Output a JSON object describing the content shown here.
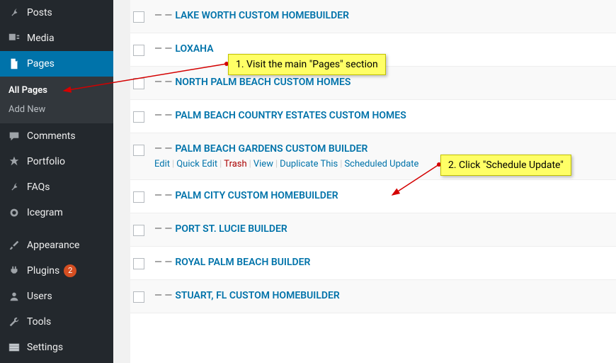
{
  "sidebar": {
    "items": [
      {
        "label": "Posts",
        "icon": "pin"
      },
      {
        "label": "Media",
        "icon": "media"
      },
      {
        "label": "Pages",
        "icon": "page",
        "active": true
      },
      {
        "label": "Comments",
        "icon": "comment"
      },
      {
        "label": "Portfolio",
        "icon": "star"
      },
      {
        "label": "FAQs",
        "icon": "pin"
      },
      {
        "label": "Icegram",
        "icon": "circle"
      },
      {
        "label": "Appearance",
        "icon": "brush"
      },
      {
        "label": "Plugins",
        "icon": "plug",
        "badge": "2"
      },
      {
        "label": "Users",
        "icon": "user"
      },
      {
        "label": "Tools",
        "icon": "wrench"
      },
      {
        "label": "Settings",
        "icon": "sliders"
      }
    ],
    "sub": {
      "all_pages": "All Pages",
      "add_new": "Add New"
    }
  },
  "pages": [
    {
      "prefix": "— —",
      "title": "LAKE WORTH CUSTOM HOMEBUILDER"
    },
    {
      "prefix": "— —",
      "title": "LOXAHA"
    },
    {
      "prefix": "— —",
      "title": "NORTH PALM BEACH CUSTOM HOMES"
    },
    {
      "prefix": "— —",
      "title": "PALM BEACH COUNTRY ESTATES CUSTOM HOMES"
    },
    {
      "prefix": "— —",
      "title": "PALM BEACH GARDENS CUSTOM BUILDER",
      "hover": true
    },
    {
      "prefix": "— —",
      "title": "PALM CITY CUSTOM HOMEBUILDER"
    },
    {
      "prefix": "— —",
      "title": "PORT ST. LUCIE BUILDER"
    },
    {
      "prefix": "— —",
      "title": "ROYAL PALM BEACH BUILDER"
    },
    {
      "prefix": "— —",
      "title": "STUART, FL CUSTOM HOMEBUILDER"
    }
  ],
  "row_actions": {
    "edit": "Edit",
    "quick_edit": "Quick Edit",
    "trash": "Trash",
    "view": "View",
    "duplicate": "Duplicate This",
    "scheduled_update": "Scheduled Update"
  },
  "callouts": {
    "a": "1. Visit the main \"Pages\" section",
    "b": "2. Click \"Schedule Update\""
  }
}
